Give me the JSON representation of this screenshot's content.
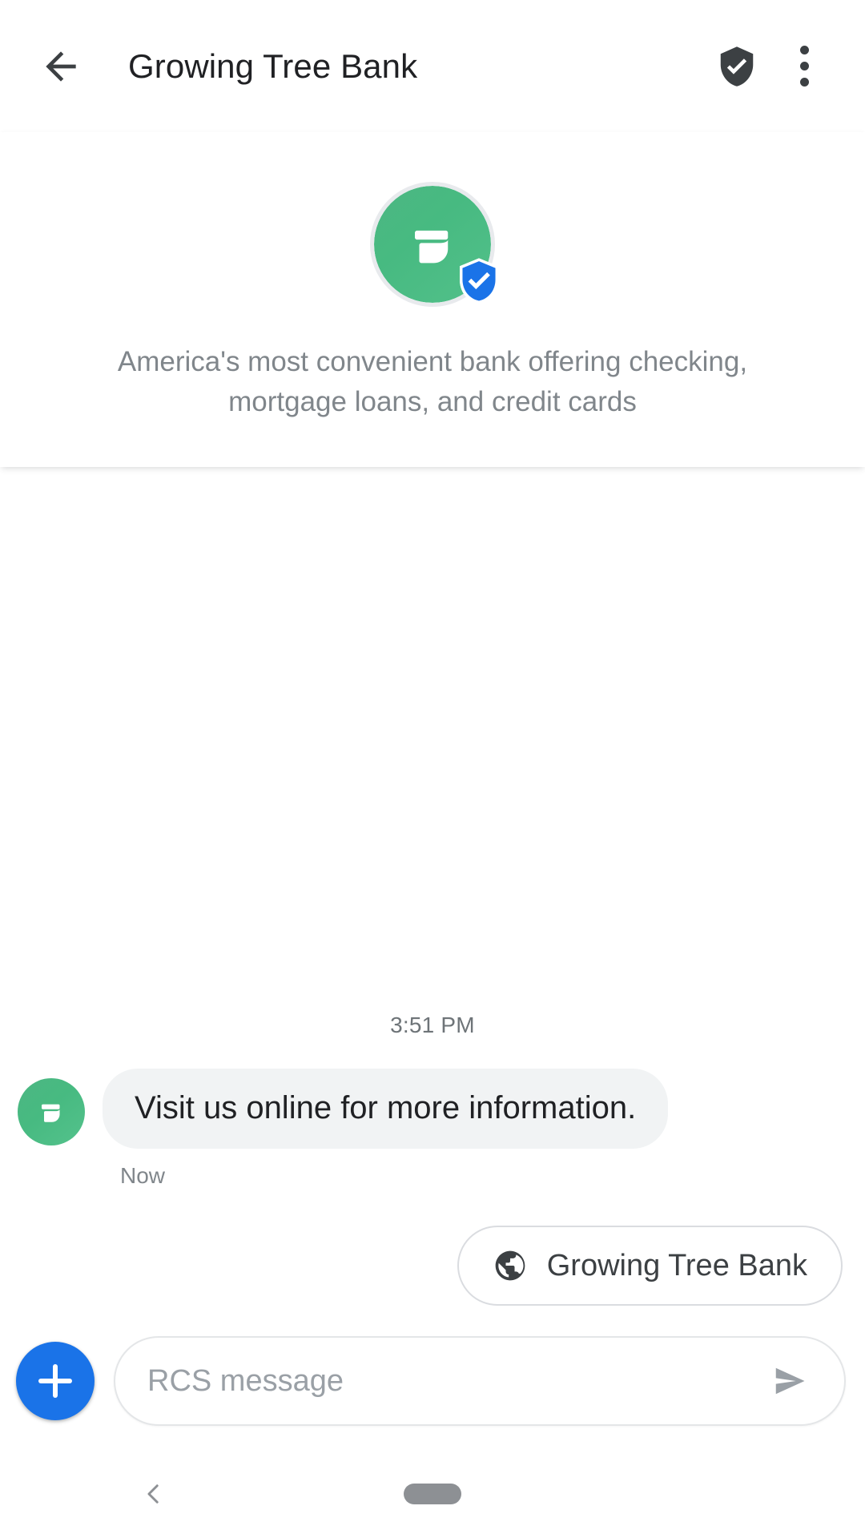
{
  "appbar": {
    "back_icon": "arrow-left-icon",
    "title": "Growing Tree Bank",
    "verified_icon": "shield-check-icon",
    "overflow_icon": "more-vert-icon"
  },
  "business_card": {
    "avatar_icon": "leaf-logo-avatar",
    "verified_badge_icon": "verified-shield-badge-icon",
    "description": "America's most convenient bank offering checking, mortgage loans, and credit cards"
  },
  "thread": {
    "timestamp_divider": "3:51 PM",
    "messages": [
      {
        "sender_avatar_icon": "leaf-logo-avatar",
        "text": "Visit us online for more information.",
        "status": "Now"
      }
    ],
    "suggested_chips": [
      {
        "icon": "globe-icon",
        "label": "Growing Tree Bank"
      }
    ]
  },
  "compose": {
    "attach_icon": "plus-icon",
    "input_value": "",
    "input_placeholder": "RCS message",
    "send_icon": "send-icon"
  },
  "navbar": {
    "back_icon": "chevron-left-icon",
    "home_pill_icon": "home-pill-icon"
  },
  "colors": {
    "brand_green": "#4cb782",
    "verified_blue": "#1a73e8",
    "accent_blue": "#1a73e8",
    "bubble_grey": "#f1f3f4",
    "text_primary": "#202124",
    "text_secondary": "#80868b",
    "divider": "#dadce0"
  }
}
